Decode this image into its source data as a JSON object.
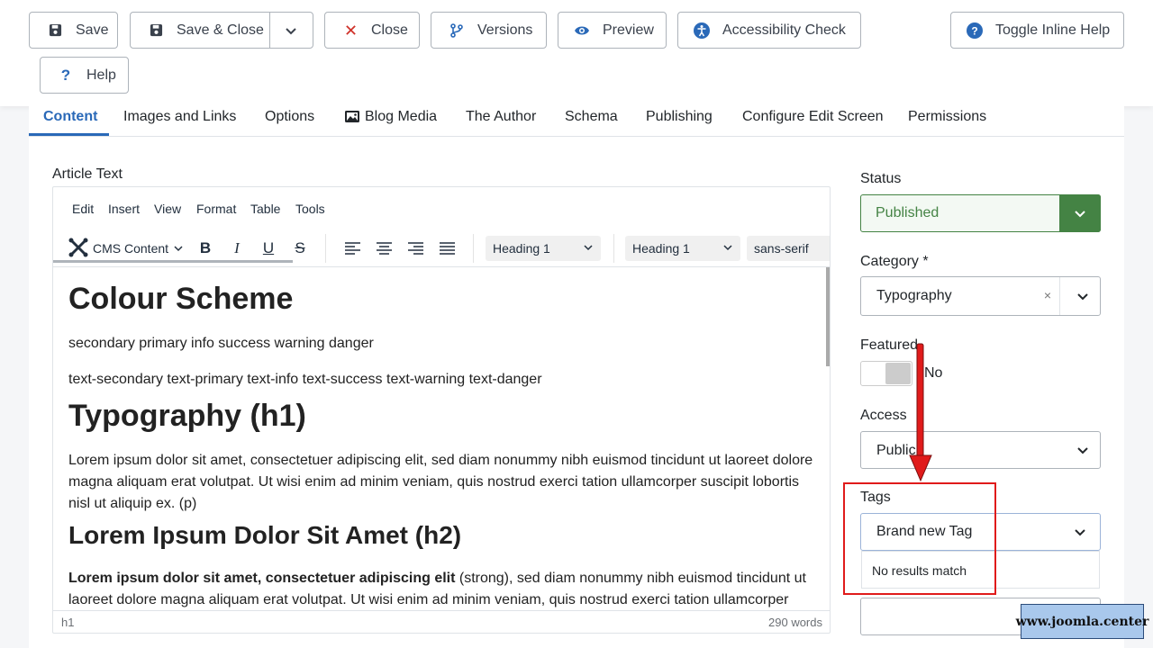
{
  "toolbar": {
    "save": "Save",
    "save_close": "Save & Close",
    "close": "Close",
    "versions": "Versions",
    "preview": "Preview",
    "accessibility": "Accessibility Check",
    "toggle_help": "Toggle Inline Help",
    "help": "Help"
  },
  "tabs": [
    "Content",
    "Images and Links",
    "Options",
    "Blog Media",
    "The Author",
    "Schema",
    "Publishing",
    "Configure Edit Screen",
    "Permissions"
  ],
  "article_text_label": "Article Text",
  "editor": {
    "menu": [
      "Edit",
      "Insert",
      "View",
      "Format",
      "Table",
      "Tools"
    ],
    "cms_content": "CMS Content",
    "block_format": "Heading 1",
    "style_format": "Heading 1",
    "font_family": "sans-serif",
    "path": "h1",
    "word_count": "290 words",
    "content": {
      "h1_colour": "Colour Scheme",
      "p_colours": "secondary primary info success warning danger",
      "p_text_colours": "text-secondary text-primary text-info text-success text-warning text-danger",
      "h1_typography": "Typography (h1)",
      "p_lorem": "Lorem ipsum dolor sit amet, consectetuer adipiscing elit, sed diam nonummy nibh euismod tincidunt ut laoreet dolore magna aliquam erat volutpat. Ut wisi enim ad minim veniam, quis nostrud exerci tation ullamcorper suscipit lobortis nisl ut aliquip ex. (p)",
      "h2_lorem": "Lorem Ipsum Dolor Sit Amet (h2)",
      "strong_text": "Lorem ipsum dolor sit amet, consectetuer adipiscing elit",
      "p_after_strong": " (strong), sed diam nonummy nibh euismod tincidunt ut laoreet dolore magna aliquam erat volutpat. Ut wisi enim ad minim veniam, quis nostrud exerci tation ullamcorper suscipit lobortis nisl ut aliquip ex. (p)"
    }
  },
  "sidebar": {
    "status_label": "Status",
    "status_value": "Published",
    "category_label": "Category *",
    "category_value": "Typography",
    "featured_label": "Featured",
    "featured_value": "No",
    "access_label": "Access",
    "access_value": "Public",
    "tags_label": "Tags",
    "tags_input": "Brand new Tag",
    "tags_no_results": "No results match"
  },
  "watermark": "www.joomla.center",
  "colors": {
    "accent": "#2a69b8",
    "published_green": "#448344",
    "annotation_red": "#e01b1b"
  }
}
